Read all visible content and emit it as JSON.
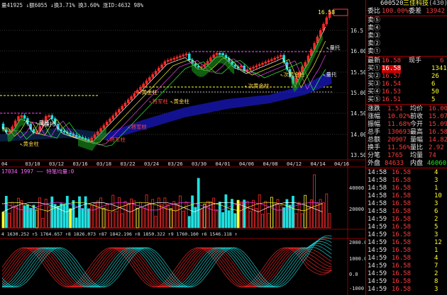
{
  "header": {
    "top_line": "量41925 ↓额6055 ↓换3.71% 换3.60% 涨ID:4632 98%",
    "vol_line": "17034 1997 —— 特笔均量:0"
  },
  "price_axis": [
    "16.5",
    "16.00",
    "15.50",
    "15.00",
    "14.50",
    "14.00",
    "13.50"
  ],
  "vol_axis": [
    "40000",
    "20000"
  ],
  "macd_axis": [
    "2000.0",
    "1000.0",
    "0.0",
    "-1000"
  ],
  "dates": [
    "04",
    "03/10",
    "03/12",
    "03/16",
    "03/18",
    "03/22",
    "03/24",
    "03/26",
    "03/30",
    "04/01",
    "04/06",
    "04/08",
    "04/12",
    "04/14",
    "04/16"
  ],
  "last_price_tag": "16.58",
  "annotations": [
    {
      "t": "黄金柱",
      "c": "#ffd54a"
    },
    {
      "t": "量托",
      "c": "#e6e6e6"
    },
    {
      "t": "将军柱",
      "c": "#ff4444"
    },
    {
      "t": "将军柱",
      "c": "#ff4444"
    },
    {
      "t": "将军柱",
      "c": "#ff4444"
    },
    {
      "t": "黄金柱",
      "c": "#ffd54a"
    },
    {
      "t": "黄金柱",
      "c": "#ffd54a"
    },
    {
      "t": "次黄金柱",
      "c": "#ffd54a"
    },
    {
      "t": "次黄金柱",
      "c": "#ffd54a"
    },
    {
      "t": "量托",
      "c": "#e6e6e6"
    },
    {
      "t": "量托",
      "c": "#e6e6e6"
    },
    {
      "t": "量托",
      "c": "#e6e6e6"
    }
  ],
  "vol_numbers": "4 1630.252 ↑5 1764.657 ↑8 1826.073 ↑87 1842.196 ↑8 1850.322 ↑9 1760.160 ↑6 1546.118 ↑",
  "quote": {
    "code": "600520",
    "name": "三佳科技",
    "name_suffix": "(430)",
    "weibi_label": "委比",
    "weibi": "100.00%",
    "weicha_label": "委差",
    "weicha": "13942",
    "asks": [
      "卖⑤",
      "卖④",
      "卖③",
      "卖②",
      "卖①"
    ],
    "bids": [
      {
        "l": "买①",
        "p": "16.58",
        "v": "13418"
      },
      {
        "l": "买②",
        "p": "16.57",
        "v": "26"
      },
      {
        "l": "买③",
        "p": "16.54",
        "v": "6"
      },
      {
        "l": "买④",
        "p": "16.53",
        "v": "50"
      },
      {
        "l": "买⑤",
        "p": "16.51",
        "v": "5"
      }
    ],
    "newest_label": "最新",
    "newest": "16.58",
    "hand_label": "现手",
    "hand": "6",
    "stats": [
      {
        "a": "涨跌",
        "b": "1.51",
        "c": "均价",
        "d": "16.00"
      },
      {
        "a": "涨幅",
        "b": "10.02%",
        "c": "前收",
        "d": "15.07"
      },
      {
        "a": "振幅",
        "b": "11.68%",
        "c": "今开",
        "d": "15.09"
      },
      {
        "a": "总手",
        "b": "130693",
        "c": "最高",
        "d": "16.58"
      },
      {
        "a": "总额",
        "b": "20907",
        "c": "量幅",
        "d": "14.82"
      },
      {
        "a": "换手",
        "b": "11.56%",
        "c": "量比",
        "d": "2.92"
      },
      {
        "a": "分笔",
        "b": "1765",
        "c": "均量",
        "d": "74"
      }
    ],
    "outer_label": "外盘",
    "outer": "84633",
    "inner_label": "内盘",
    "inner": "46060",
    "ticks": [
      {
        "t": "14:58",
        "p": "16.58",
        "v": "4"
      },
      {
        "t": "14:58",
        "p": "16.58",
        "v": "3"
      },
      {
        "t": "14:58",
        "p": "16.58",
        "v": "1"
      },
      {
        "t": "14:58",
        "p": "16.58",
        "v": "10"
      },
      {
        "t": "14:58",
        "p": "16.58",
        "v": "3"
      },
      {
        "t": "14:58",
        "p": "16.58",
        "v": "6"
      },
      {
        "t": "14:59",
        "p": "16.58",
        "v": "2"
      },
      {
        "t": "14:59",
        "p": "16.58",
        "v": "5"
      },
      {
        "t": "14:59",
        "p": "16.58",
        "v": "3"
      },
      {
        "t": "14:59",
        "p": "16.58",
        "v": "12"
      },
      {
        "t": "14:59",
        "p": "16.58",
        "v": "1"
      },
      {
        "t": "14:59",
        "p": "16.58",
        "v": "4"
      },
      {
        "t": "14:59",
        "p": "16.58",
        "v": "7"
      },
      {
        "t": "14:59",
        "p": "16.58",
        "v": "2"
      },
      {
        "t": "14:59",
        "p": "16.58",
        "v": "8"
      },
      {
        "t": "14:59",
        "p": "16.58",
        "v": "3"
      },
      {
        "t": "14:59",
        "p": "16.58",
        "v": "5"
      },
      {
        "t": "15:00",
        "p": "16.58",
        "v": "6"
      }
    ]
  }
}
